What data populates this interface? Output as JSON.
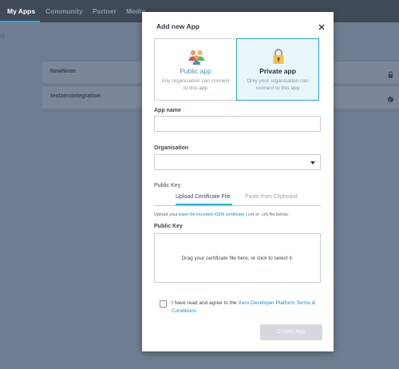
{
  "nav": {
    "items": [
      "My Apps",
      "Community",
      "Partner",
      "Media"
    ],
    "active": "My Apps"
  },
  "background": {
    "subtext": "s)",
    "apps": [
      {
        "name": "NewNeon",
        "icon": "lock-icon"
      },
      {
        "name": "testzerointegration",
        "icon": "globe-icon"
      }
    ]
  },
  "modal": {
    "title": "Add new App",
    "close_icon": "close-icon",
    "public": {
      "title": "Public app",
      "description": "Any organisation can connect to this app",
      "icon": "people-icon"
    },
    "private": {
      "title": "Private app",
      "description": "Only your organisation can connect to this app",
      "icon": "padlock-icon",
      "selected": true
    },
    "app_name_label": "App name",
    "app_name_value": "",
    "organisation_label": "Organisation",
    "organisation_value": "",
    "public_key_section_label": "Public Key",
    "tabs": {
      "upload": "Upload Certificate File",
      "paste": "Paste from Clipboard",
      "active": "upload"
    },
    "upload_hint": {
      "prefix": "Upload your ",
      "link": "base-64 encoded X509 certificate",
      "suffix": " (.cer or .crt) file below."
    },
    "public_key_label": "Public Key",
    "dropzone_text": "Drag your certificate file here, or click to select it.",
    "agree": {
      "prefix": "I have read and agree to the ",
      "link": "Xero Developer Platform Terms & Conditions",
      "checked": false
    },
    "create_button": "Create App"
  },
  "colors": {
    "accent": "#1ab4d7",
    "link": "#1a8cc6",
    "nav_bg": "#404a56",
    "overlay_bg": "#6f7d90"
  }
}
